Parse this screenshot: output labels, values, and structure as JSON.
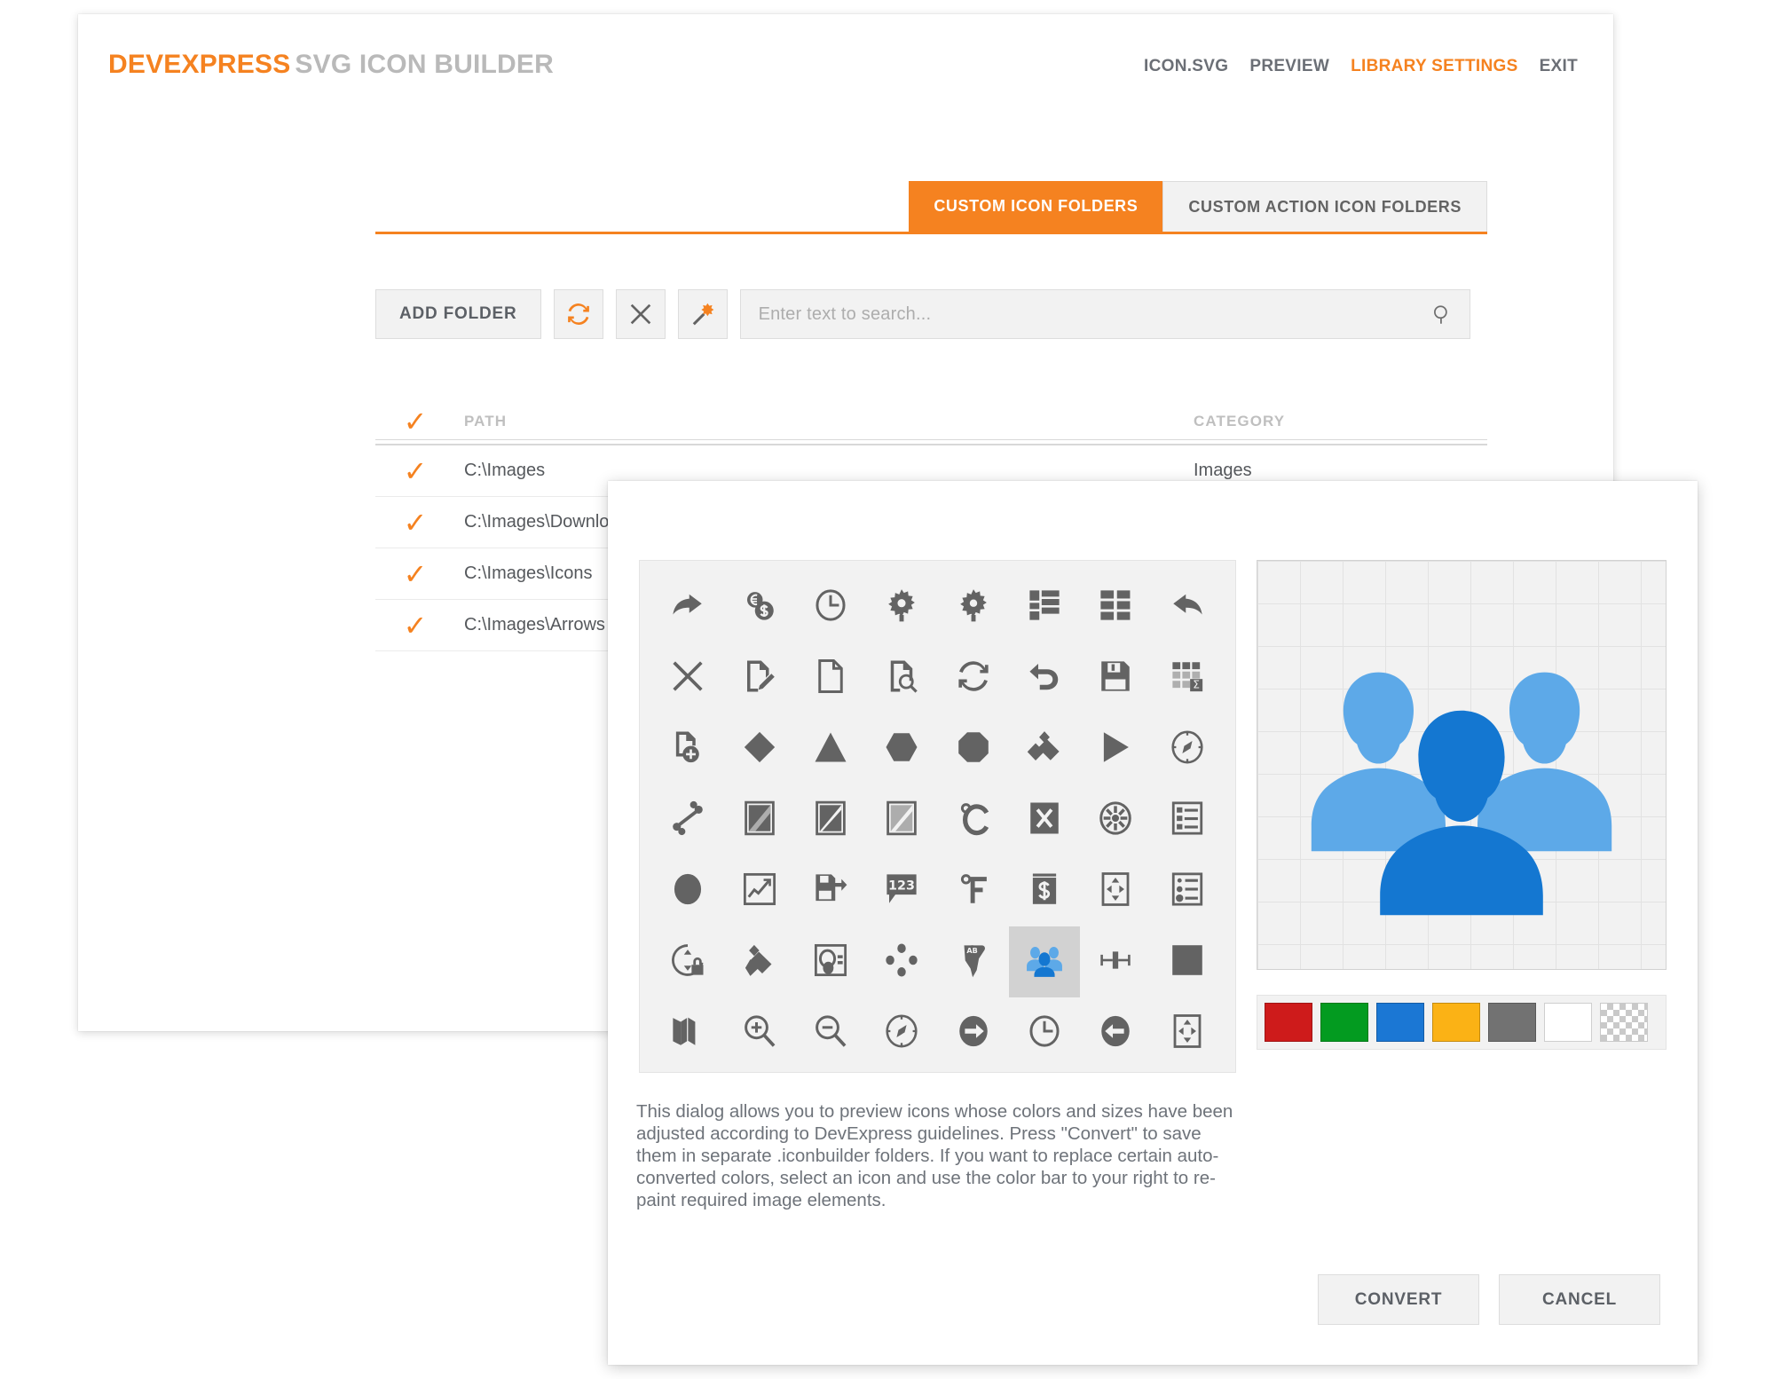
{
  "header": {
    "logo_brand": "DEVEXPRESS",
    "logo_suffix": "SVG ICON BUILDER",
    "nav": [
      {
        "label": "ICON.SVG",
        "active": false
      },
      {
        "label": "PREVIEW",
        "active": false
      },
      {
        "label": "LIBRARY SETTINGS",
        "active": true
      },
      {
        "label": "EXIT",
        "active": false
      }
    ]
  },
  "tabs": [
    {
      "label": "CUSTOM ICON FOLDERS",
      "active": true
    },
    {
      "label": "CUSTOM ACTION ICON FOLDERS",
      "active": false
    }
  ],
  "toolbar": {
    "add_folder_label": "ADD FOLDER",
    "refresh_icon": "refresh-icon",
    "delete_icon": "close-x-icon",
    "magic_wand_icon": "magic-wand-icon",
    "search_placeholder": "Enter text to search...",
    "search_value": "",
    "search_icon": "search-icon"
  },
  "table": {
    "columns": [
      "PATH",
      "CATEGORY"
    ],
    "header_check": "✓",
    "rows": [
      {
        "checked": "✓",
        "path": "C:\\Images",
        "category": "Images"
      },
      {
        "checked": "✓",
        "path": "C:\\Images\\Downloads",
        "category": ""
      },
      {
        "checked": "✓",
        "path": "C:\\Images\\Icons",
        "category": ""
      },
      {
        "checked": "✓",
        "path": "C:\\Images\\Arrows",
        "category": ""
      }
    ]
  },
  "dialog": {
    "description": "This dialog allows you to preview icons whose colors and sizes have been adjusted according to DevExpress guidelines. Press \"Convert\" to save them in separate .iconbuilder folders. If you want to replace certain auto-converted colors, select an icon and use the color bar to your right to re-paint required image elements.",
    "convert_label": "CONVERT",
    "cancel_label": "CANCEL",
    "icon_grid": [
      {
        "name": "redo-arrow-icon",
        "selected": false
      },
      {
        "name": "currency-coins-icon",
        "selected": false
      },
      {
        "name": "clock-icon",
        "selected": false
      },
      {
        "name": "gear-icon",
        "selected": false
      },
      {
        "name": "gear-alt-icon",
        "selected": false
      },
      {
        "name": "layout-blocks-icon",
        "selected": false
      },
      {
        "name": "grid-tiles-icon",
        "selected": false
      },
      {
        "name": "undo-arrow-icon",
        "selected": false
      },
      {
        "name": "close-x-icon",
        "selected": false
      },
      {
        "name": "edit-document-icon",
        "selected": false
      },
      {
        "name": "document-icon",
        "selected": false
      },
      {
        "name": "document-search-icon",
        "selected": false
      },
      {
        "name": "refresh-icon",
        "selected": false
      },
      {
        "name": "undo-curve-icon",
        "selected": false
      },
      {
        "name": "save-floppy-icon",
        "selected": false
      },
      {
        "name": "grid-sum-icon",
        "selected": false
      },
      {
        "name": "new-document-icon",
        "selected": false
      },
      {
        "name": "diamond-shape-icon",
        "selected": false
      },
      {
        "name": "triangle-shape-icon",
        "selected": false
      },
      {
        "name": "hexagon-shape-icon",
        "selected": false
      },
      {
        "name": "octagon-shape-icon",
        "selected": false
      },
      {
        "name": "kite-shape-icon",
        "selected": false
      },
      {
        "name": "play-triangle-icon",
        "selected": false
      },
      {
        "name": "compass-icon",
        "selected": false
      },
      {
        "name": "connector-nodes-icon",
        "selected": false
      },
      {
        "name": "gradient-box-a-icon",
        "selected": false
      },
      {
        "name": "gradient-box-b-icon",
        "selected": false
      },
      {
        "name": "gradient-box-c-icon",
        "selected": false
      },
      {
        "name": "celsius-icon",
        "selected": false
      },
      {
        "name": "close-filled-icon",
        "selected": false
      },
      {
        "name": "wheel-spokes-icon",
        "selected": false
      },
      {
        "name": "list-details-icon",
        "selected": false
      },
      {
        "name": "ellipse-filled-icon",
        "selected": false
      },
      {
        "name": "chart-line-icon",
        "selected": false
      },
      {
        "name": "save-as-icon",
        "selected": false
      },
      {
        "name": "number-123-icon",
        "selected": false
      },
      {
        "name": "fahrenheit-icon",
        "selected": false
      },
      {
        "name": "dollar-book-icon",
        "selected": false
      },
      {
        "name": "move-arrows-icon",
        "selected": false
      },
      {
        "name": "list-bullets-icon",
        "selected": false
      },
      {
        "name": "lock-rotate-icon",
        "selected": false
      },
      {
        "name": "highlighter-icon",
        "selected": false
      },
      {
        "name": "photo-portrait-icon",
        "selected": false
      },
      {
        "name": "dots-diamond-icon",
        "selected": false
      },
      {
        "name": "africa-ab-icon",
        "selected": false
      },
      {
        "name": "people-group-icon",
        "selected": true
      },
      {
        "name": "align-center-h-icon",
        "selected": false
      },
      {
        "name": "square-filled-icon",
        "selected": false
      },
      {
        "name": "map-icon",
        "selected": false
      },
      {
        "name": "zoom-in-icon",
        "selected": false
      },
      {
        "name": "zoom-out-icon",
        "selected": false
      },
      {
        "name": "compass-outline-icon",
        "selected": false
      },
      {
        "name": "arrow-right-circle-icon",
        "selected": false
      },
      {
        "name": "clock-outline-icon",
        "selected": false
      },
      {
        "name": "arrow-left-circle-icon",
        "selected": false
      },
      {
        "name": "move-box-icon",
        "selected": false
      }
    ],
    "preview": {
      "icon_name": "people-group-icon",
      "color_front": "#1477D1",
      "color_back": "#5DA9E8"
    },
    "colors": [
      {
        "name": "red-swatch",
        "hex": "#CE1B1B"
      },
      {
        "name": "green-swatch",
        "hex": "#039B20"
      },
      {
        "name": "blue-swatch",
        "hex": "#1B77D4"
      },
      {
        "name": "amber-swatch",
        "hex": "#FBB215"
      },
      {
        "name": "gray-swatch",
        "hex": "#727272"
      },
      {
        "name": "white-swatch",
        "hex": "#FFFFFF"
      },
      {
        "name": "transparent-swatch",
        "hex": "transparent"
      }
    ]
  },
  "theme": {
    "accent": "#F58220",
    "icon_gray": "#636363",
    "text_gray": "#55585C"
  }
}
